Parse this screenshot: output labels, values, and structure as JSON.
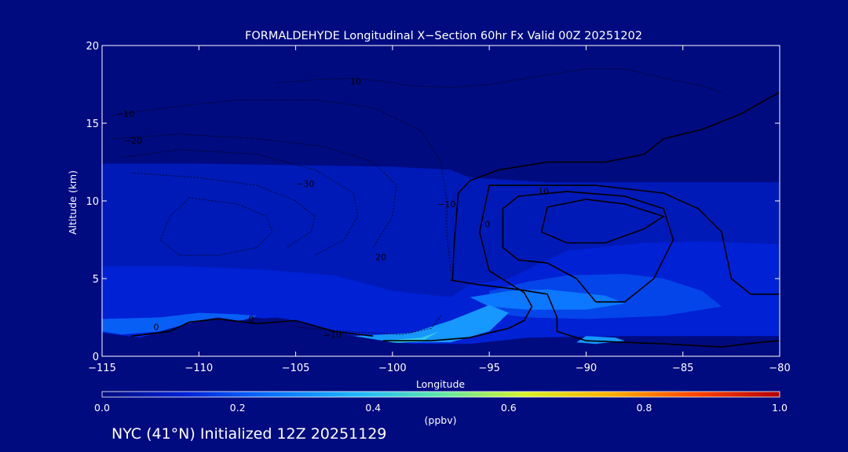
{
  "chart_data": {
    "type": "heatmap",
    "title": "FORMALDEHYDE Longitudinal X−Section 60hr  Fx Valid 00Z 20251202",
    "xlabel": "Longitude",
    "ylabel": "Altitude (km)",
    "xlim": [
      -115,
      -80
    ],
    "ylim": [
      0,
      20
    ],
    "x_ticks": [
      -115,
      -110,
      -105,
      -100,
      -95,
      -90,
      -85,
      -80
    ],
    "x_tick_labels": [
      "−115",
      "−110",
      "−105",
      "−100",
      "−95",
      "−90",
      "−85",
      "−80"
    ],
    "y_ticks": [
      0,
      5,
      10,
      15,
      20
    ],
    "y_tick_labels": [
      "0",
      "5",
      "10",
      "15",
      "20"
    ],
    "colorbar": {
      "label": "(ppbv)",
      "range": [
        0.0,
        1.0
      ],
      "tick_labels": [
        "0.0",
        "0.2",
        "0.4",
        "0.6",
        "0.8",
        "1.0"
      ],
      "ticks": [
        0.0,
        0.2,
        0.4,
        0.6,
        0.8,
        1.0
      ],
      "colors": [
        "#000b80",
        "#0022d8",
        "#0a72ff",
        "#1fb6ff",
        "#5fe8a8",
        "#d8f22a",
        "#ffb000",
        "#ff4500",
        "#b00000"
      ]
    },
    "field_regions": [
      {
        "level": 0.08,
        "points": [
          [
            -115,
            12.4
          ],
          [
            -110,
            12.4
          ],
          [
            -105,
            12.3
          ],
          [
            -100,
            12.2
          ],
          [
            -97,
            12
          ],
          [
            -96,
            11.5
          ],
          [
            -92,
            11.2
          ],
          [
            -85,
            11.2
          ],
          [
            -80,
            11.2
          ],
          [
            -80,
            2
          ],
          [
            -90,
            2
          ],
          [
            -97,
            1
          ],
          [
            -100,
            0.8
          ],
          [
            -104,
            1.8
          ],
          [
            -107,
            2.5
          ],
          [
            -110,
            2.4
          ],
          [
            -113,
            1.2
          ],
          [
            -115,
            1.5
          ]
        ]
      },
      {
        "level": 0.12,
        "points": [
          [
            -115,
            5.8
          ],
          [
            -111,
            5.8
          ],
          [
            -107,
            5.6
          ],
          [
            -103,
            5.2
          ],
          [
            -100,
            4.2
          ],
          [
            -97,
            3.8
          ],
          [
            -96,
            4.6
          ],
          [
            -94,
            5
          ],
          [
            -91,
            6.8
          ],
          [
            -87,
            7.3
          ],
          [
            -84,
            7.4
          ],
          [
            -80,
            7.2
          ],
          [
            -80,
            1.3
          ],
          [
            -88,
            1.3
          ],
          [
            -93,
            1.2
          ],
          [
            -96,
            0.8
          ],
          [
            -99,
            0.8
          ],
          [
            -103,
            1.6
          ],
          [
            -107,
            2.5
          ],
          [
            -110,
            2.4
          ],
          [
            -113,
            1.2
          ],
          [
            -115,
            1.5
          ]
        ]
      },
      {
        "level": 0.18,
        "points": [
          [
            -95,
            4.2
          ],
          [
            -93,
            4.8
          ],
          [
            -91,
            5.2
          ],
          [
            -88,
            5.3
          ],
          [
            -86,
            5
          ],
          [
            -84,
            4.2
          ],
          [
            -83,
            3.2
          ],
          [
            -86,
            2.6
          ],
          [
            -90,
            2.4
          ],
          [
            -93,
            2.5
          ],
          [
            -95,
            2.8
          ]
        ]
      },
      {
        "level": 0.22,
        "points": [
          [
            -115,
            2.4
          ],
          [
            -112,
            2.5
          ],
          [
            -110,
            2.8
          ],
          [
            -108,
            2.7
          ],
          [
            -107,
            2.6
          ],
          [
            -108,
            2.2
          ],
          [
            -110,
            2.3
          ],
          [
            -112,
            1.6
          ],
          [
            -114,
            1.4
          ],
          [
            -115,
            1.6
          ]
        ]
      },
      {
        "level": 0.26,
        "points": [
          [
            -96,
            3.8
          ],
          [
            -94,
            4.2
          ],
          [
            -92,
            4.3
          ],
          [
            -89,
            3.9
          ],
          [
            -88,
            3.4
          ],
          [
            -90,
            3
          ],
          [
            -93,
            3
          ],
          [
            -95,
            3.2
          ]
        ]
      },
      {
        "level": 0.32,
        "points": [
          [
            -102,
            1.3
          ],
          [
            -99,
            1.5
          ],
          [
            -97,
            2.3
          ],
          [
            -95,
            3.3
          ],
          [
            -94,
            2.8
          ],
          [
            -95,
            1.6
          ],
          [
            -97,
            0.9
          ],
          [
            -100,
            0.9
          ]
        ]
      },
      {
        "level": 0.42,
        "points": [
          [
            -100.5,
            1
          ],
          [
            -98.5,
            1.2
          ],
          [
            -97.6,
            1.6
          ],
          [
            -98.5,
            0.95
          ],
          [
            -100,
            0.85
          ]
        ]
      },
      {
        "level": 0.32,
        "points": [
          [
            -90,
            1.3
          ],
          [
            -88.5,
            1.2
          ],
          [
            -88,
            1
          ],
          [
            -89.5,
            0.8
          ],
          [
            -90.5,
            0.9
          ]
        ]
      }
    ],
    "terrain": [
      [
        -115,
        1.4
      ],
      [
        -114,
        1.3
      ],
      [
        -113,
        1.2
      ],
      [
        -112,
        1.3
      ],
      [
        -111,
        1.7
      ],
      [
        -110,
        2.3
      ],
      [
        -109,
        2.5
      ],
      [
        -108,
        2.3
      ],
      [
        -107,
        2.4
      ],
      [
        -106,
        2.5
      ],
      [
        -105,
        2.3
      ],
      [
        -104,
        1.9
      ],
      [
        -103,
        1.6
      ],
      [
        -102,
        1.3
      ],
      [
        -101,
        1.1
      ],
      [
        -100,
        0.9
      ],
      [
        -99,
        0.8
      ],
      [
        -98,
        0.75
      ],
      [
        -97,
        0.65
      ],
      [
        -96,
        0.55
      ],
      [
        -95,
        0.45
      ],
      [
        -94,
        0.4
      ],
      [
        -93,
        0.35
      ],
      [
        -92,
        0.3
      ],
      [
        -90,
        0.25
      ],
      [
        -85,
        0.2
      ],
      [
        -80,
        0.15
      ]
    ],
    "contours": [
      {
        "level": 0,
        "style": "solid",
        "points": [
          [
            -96.9,
            4.9
          ],
          [
            -96.8,
            7.5
          ],
          [
            -96.6,
            10.5
          ],
          [
            -96,
            11.3
          ],
          [
            -94.5,
            12
          ],
          [
            -92,
            12.5
          ],
          [
            -89,
            12.5
          ],
          [
            -87,
            13
          ],
          [
            -86,
            14
          ],
          [
            -84,
            14.6
          ],
          [
            -82,
            15.6
          ],
          [
            -80,
            17
          ]
        ]
      },
      {
        "level": 0,
        "style": "solid",
        "points": [
          [
            -97,
            4.9
          ],
          [
            -95.5,
            4.6
          ],
          [
            -93.5,
            4.3
          ],
          [
            -92,
            4
          ],
          [
            -91.5,
            2.5
          ],
          [
            -91.5,
            1.6
          ],
          [
            -90,
            1
          ],
          [
            -86,
            0.8
          ],
          [
            -83,
            0.6
          ],
          [
            -81,
            0.9
          ],
          [
            -80,
            1
          ]
        ]
      },
      {
        "level": 0,
        "style": "solid",
        "points": [
          [
            -113.5,
            1.3
          ],
          [
            -111.5,
            1.6
          ],
          [
            -110.5,
            2.2
          ],
          [
            -109,
            2.4
          ],
          [
            -107,
            2.1
          ]
        ]
      },
      {
        "level": 0,
        "style": "solid",
        "points": [
          [
            -107,
            2.1
          ],
          [
            -105,
            2.3
          ],
          [
            -103,
            1.6
          ],
          [
            -101,
            1.3
          ]
        ]
      },
      {
        "level": 10,
        "style": "solid",
        "points": [
          [
            -95.5,
            8
          ],
          [
            -95,
            11
          ],
          [
            -92.5,
            11
          ],
          [
            -89.5,
            11
          ],
          [
            -86,
            10.5
          ],
          [
            -84.2,
            9.5
          ],
          [
            -83,
            8
          ],
          [
            -82.5,
            5
          ],
          [
            -81.5,
            4
          ],
          [
            -80,
            4
          ]
        ]
      },
      {
        "level": 10,
        "style": "solid",
        "points": [
          [
            -95.5,
            8
          ],
          [
            -95,
            5.5
          ],
          [
            -93.2,
            4.1
          ],
          [
            -92.8,
            3.2
          ],
          [
            -93.2,
            2.3
          ],
          [
            -94,
            1.8
          ],
          [
            -96,
            1.2
          ],
          [
            -98,
            1
          ],
          [
            -100.5,
            1
          ]
        ]
      },
      {
        "level": 20,
        "style": "solid",
        "points": [
          [
            -94.3,
            9.5
          ],
          [
            -93.5,
            10.3
          ],
          [
            -91,
            10.6
          ],
          [
            -88,
            10.3
          ],
          [
            -86,
            9.5
          ],
          [
            -85.5,
            7.5
          ],
          [
            -86.5,
            5
          ],
          [
            -88,
            3.5
          ],
          [
            -89.5,
            3.5
          ],
          [
            -90.5,
            5
          ],
          [
            -92,
            6
          ],
          [
            -93.5,
            6.2
          ],
          [
            -94.3,
            7
          ],
          [
            -94.3,
            9.5
          ]
        ]
      },
      {
        "level": 30,
        "style": "solid",
        "points": [
          [
            -92.3,
            8
          ],
          [
            -92,
            9.6
          ],
          [
            -90,
            10.1
          ],
          [
            -88,
            9.8
          ],
          [
            -86,
            9
          ],
          [
            -87,
            8.2
          ],
          [
            -89,
            7.3
          ],
          [
            -91,
            7.3
          ],
          [
            -92.3,
            8
          ]
        ]
      },
      {
        "level": -10,
        "style": "dashed",
        "points": [
          [
            -106,
            17.6
          ],
          [
            -104,
            17.8
          ],
          [
            -102,
            17.9
          ],
          [
            -100.5,
            17.7
          ],
          [
            -99,
            17.4
          ],
          [
            -97,
            17.3
          ],
          [
            -95,
            17.5
          ],
          [
            -92,
            18.1
          ],
          [
            -90,
            18.5
          ],
          [
            -88,
            18.5
          ],
          [
            -86,
            17.9
          ],
          [
            -84,
            17.4
          ],
          [
            -83,
            17
          ]
        ]
      },
      {
        "level": -10,
        "style": "dashed",
        "points": [
          [
            -114.5,
            15.5
          ],
          [
            -111,
            16.1
          ],
          [
            -108,
            16.5
          ],
          [
            -104,
            16.5
          ],
          [
            -101,
            16
          ],
          [
            -98.5,
            14.5
          ],
          [
            -97.5,
            12.5
          ],
          [
            -97.2,
            10
          ],
          [
            -97.2,
            8
          ],
          [
            -97,
            5.5
          ]
        ]
      },
      {
        "level": -10,
        "style": "dashed",
        "points": [
          [
            -105,
            1.9
          ],
          [
            -102.5,
            1.6
          ],
          [
            -99.5,
            1.4
          ],
          [
            -98,
            1.8
          ],
          [
            -97.5,
            2.6
          ]
        ]
      },
      {
        "level": -20,
        "style": "dashed",
        "points": [
          [
            -114.5,
            14
          ],
          [
            -111,
            14.3
          ],
          [
            -107,
            14
          ],
          [
            -103.5,
            13.5
          ],
          [
            -101,
            12.5
          ],
          [
            -99.8,
            11
          ],
          [
            -100,
            9
          ],
          [
            -101,
            7
          ]
        ]
      },
      {
        "level": -30,
        "style": "dashed",
        "points": [
          [
            -114,
            12.8
          ],
          [
            -111,
            13.3
          ],
          [
            -107,
            13
          ],
          [
            -104,
            12
          ],
          [
            -102,
            10.5
          ],
          [
            -101.8,
            9
          ],
          [
            -102.5,
            7.5
          ],
          [
            -104,
            6.5
          ]
        ]
      },
      {
        "level": -40,
        "style": "dashed",
        "points": [
          [
            -113.5,
            11.8
          ],
          [
            -110,
            11.5
          ],
          [
            -107,
            11
          ],
          [
            -105,
            10
          ],
          [
            -104,
            9
          ],
          [
            -104.2,
            8
          ],
          [
            -105.5,
            7
          ]
        ]
      },
      {
        "level": -50,
        "style": "dashed",
        "points": [
          [
            -110.5,
            10.2
          ],
          [
            -108,
            9.8
          ],
          [
            -106.5,
            9
          ],
          [
            -106.2,
            8
          ],
          [
            -107,
            7
          ],
          [
            -109,
            6.5
          ],
          [
            -111,
            6.5
          ],
          [
            -112,
            7.5
          ],
          [
            -111.5,
            9
          ],
          [
            -110.5,
            10.2
          ]
        ]
      }
    ],
    "contour_labels": [
      {
        "text": "10",
        "x": -101.9,
        "y": 17.7
      },
      {
        "text": "−10",
        "x": -113.8,
        "y": 15.6
      },
      {
        "text": "−20",
        "x": -113.4,
        "y": 13.9
      },
      {
        "text": "−30",
        "x": -104.5,
        "y": 11.1
      },
      {
        "text": "−10",
        "x": -97.2,
        "y": 9.8
      },
      {
        "text": "0",
        "x": -95.1,
        "y": 8.5
      },
      {
        "text": "10",
        "x": -92.2,
        "y": 10.6
      },
      {
        "text": "20",
        "x": -100.6,
        "y": 6.4
      },
      {
        "text": "0",
        "x": -112.2,
        "y": 1.9
      },
      {
        "text": "0",
        "x": -107.3,
        "y": 2.4
      },
      {
        "text": "−10",
        "x": -103.1,
        "y": 1.4
      }
    ]
  },
  "footer": "NYC (41°N) Initialized 12Z 20251129"
}
